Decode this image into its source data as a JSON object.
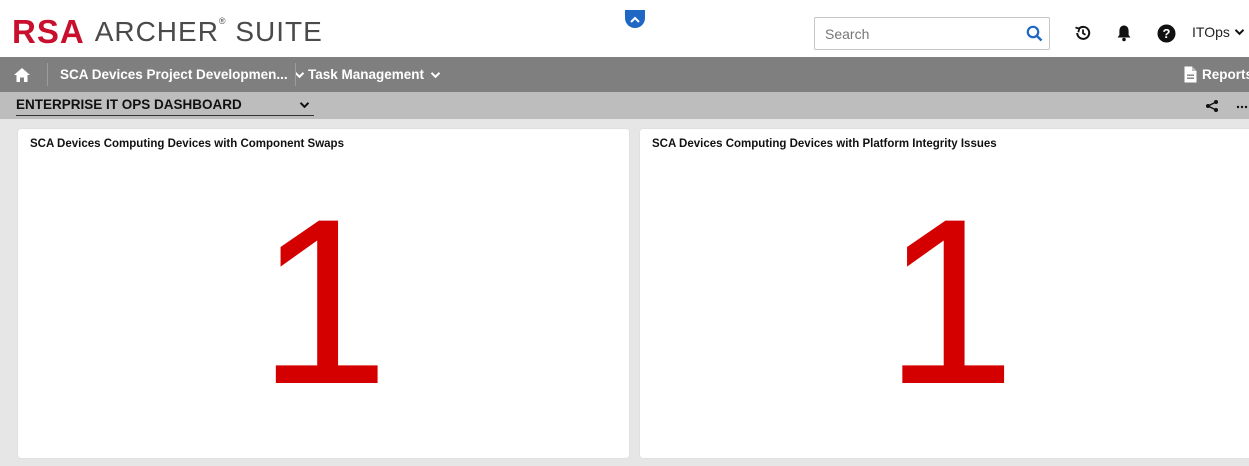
{
  "header": {
    "logo_brand": "RSA",
    "logo_product": "ARCHER",
    "logo_suite": "SUITE",
    "logo_mark": "®",
    "search_placeholder": "Search",
    "user_name": "ITOps"
  },
  "nav": {
    "items": [
      {
        "label": "SCA Devices Project Developmen..."
      },
      {
        "label": "Task Management"
      }
    ],
    "reports_label": "Reports"
  },
  "dashboard": {
    "selected": "ENTERPRISE IT OPS DASHBOARD"
  },
  "cards": [
    {
      "title": "SCA Devices Computing Devices with Component Swaps",
      "value": "1"
    },
    {
      "title": "SCA Devices Computing Devices with Platform Integrity Issues",
      "value": "1"
    }
  ],
  "colors": {
    "brand_red": "#c8102e",
    "value_red": "#d40000",
    "accent_blue": "#1f67c4",
    "nav_bg": "#7f7f7f",
    "dashbar_bg": "#bdbdbd"
  },
  "icons": {
    "collapse": "chevron-up-icon",
    "search": "search-icon",
    "history": "history-icon",
    "notifications": "bell-icon",
    "help": "help-icon",
    "home": "home-icon",
    "reports": "document-icon",
    "share": "share-icon",
    "more": "more-icon"
  }
}
